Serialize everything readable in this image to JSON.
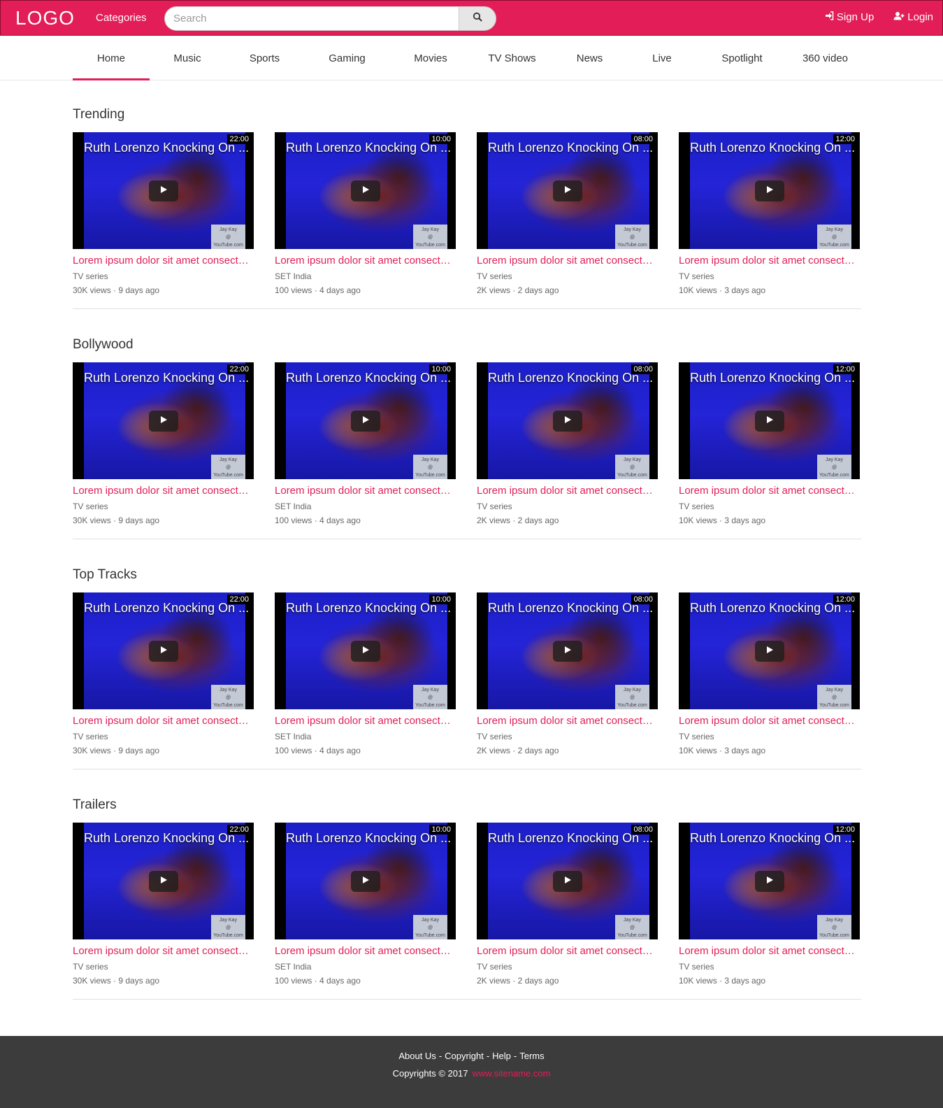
{
  "header": {
    "logo": "LOGO",
    "categories_label": "Categories",
    "search_placeholder": "Search",
    "signup_label": "Sign Up",
    "login_label": "Login"
  },
  "nav": {
    "tabs": [
      "Home",
      "Music",
      "Sports",
      "Gaming",
      "Movies",
      "TV Shows",
      "News",
      "Live",
      "Spotlight",
      "360 video"
    ],
    "active_tab": "Home"
  },
  "colors": {
    "brand": "#e21d57",
    "footer_bg": "#3c3c3c"
  },
  "video_overlay_title": "Ruth Lorenzo Knocking On ...",
  "watermark": "Jay Kay\n@\nYouTube.com",
  "sections": [
    {
      "title": "Trending",
      "cards": [
        {
          "duration": "22:00",
          "title": "Lorem ipsum dolor sit amet consectetur",
          "channel": "TV series",
          "meta": "30K views · 9 days ago"
        },
        {
          "duration": "10:00",
          "title": "Lorem ipsum dolor sit amet consectetur",
          "channel": "SET India",
          "meta": "100 views · 4 days ago"
        },
        {
          "duration": "08:00",
          "title": "Lorem ipsum dolor sit amet consectetur",
          "channel": "TV series",
          "meta": "2K views · 2 days ago"
        },
        {
          "duration": "12:00",
          "title": "Lorem ipsum dolor sit amet consectetur",
          "channel": "TV series",
          "meta": "10K views · 3 days ago"
        }
      ]
    },
    {
      "title": "Bollywood",
      "cards": [
        {
          "duration": "22:00",
          "title": "Lorem ipsum dolor sit amet consectetur",
          "channel": "TV series",
          "meta": "30K views · 9 days ago"
        },
        {
          "duration": "10:00",
          "title": "Lorem ipsum dolor sit amet consectetur",
          "channel": "SET India",
          "meta": "100 views · 4 days ago"
        },
        {
          "duration": "08:00",
          "title": "Lorem ipsum dolor sit amet consectetur",
          "channel": "TV series",
          "meta": "2K views · 2 days ago"
        },
        {
          "duration": "12:00",
          "title": "Lorem ipsum dolor sit amet consectetur",
          "channel": "TV series",
          "meta": "10K views · 3 days ago"
        }
      ]
    },
    {
      "title": "Top Tracks",
      "cards": [
        {
          "duration": "22:00",
          "title": "Lorem ipsum dolor sit amet consectetur",
          "channel": "TV series",
          "meta": "30K views · 9 days ago"
        },
        {
          "duration": "10:00",
          "title": "Lorem ipsum dolor sit amet consectetur",
          "channel": "SET India",
          "meta": "100 views · 4 days ago"
        },
        {
          "duration": "08:00",
          "title": "Lorem ipsum dolor sit amet consectetur",
          "channel": "TV series",
          "meta": "2K views · 2 days ago"
        },
        {
          "duration": "12:00",
          "title": "Lorem ipsum dolor sit amet consectetur",
          "channel": "TV series",
          "meta": "10K views · 3 days ago"
        }
      ]
    },
    {
      "title": "Trailers",
      "cards": [
        {
          "duration": "22:00",
          "title": "Lorem ipsum dolor sit amet consectetur",
          "channel": "TV series",
          "meta": "30K views · 9 days ago"
        },
        {
          "duration": "10:00",
          "title": "Lorem ipsum dolor sit amet consectetur",
          "channel": "SET India",
          "meta": "100 views · 4 days ago"
        },
        {
          "duration": "08:00",
          "title": "Lorem ipsum dolor sit amet consectetur",
          "channel": "TV series",
          "meta": "2K views · 2 days ago"
        },
        {
          "duration": "12:00",
          "title": "Lorem ipsum dolor sit amet consectetur",
          "channel": "TV series",
          "meta": "10K views · 3 days ago"
        }
      ]
    }
  ],
  "footer": {
    "links": [
      "About Us",
      "Copyright",
      "Help",
      "Terms"
    ],
    "separator": "-",
    "copyright": "Copyrights © 2017",
    "site": "www.sitename.com"
  }
}
